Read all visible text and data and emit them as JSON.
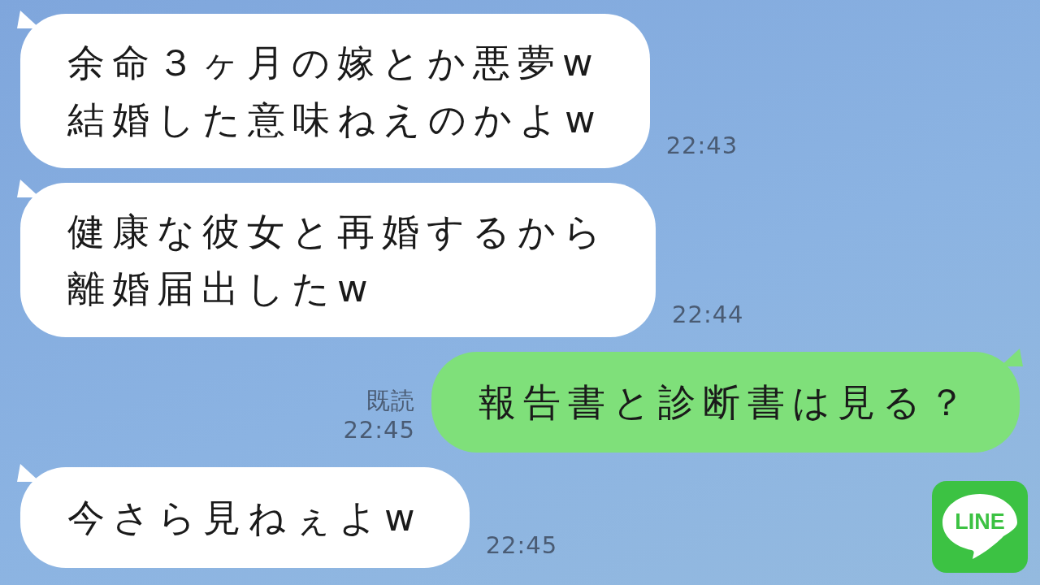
{
  "messages": [
    {
      "kind": "incoming",
      "lines": [
        "余命３ヶ月の嫁とか悪夢w",
        "結婚した意味ねえのかよw"
      ],
      "time": "22:43"
    },
    {
      "kind": "incoming",
      "lines": [
        "健康な彼女と再婚するから",
        "離婚届出したw"
      ],
      "time": "22:44"
    },
    {
      "kind": "outgoing",
      "lines": [
        "報告書と診断書は見る？"
      ],
      "read": "既読",
      "time": "22:45"
    },
    {
      "kind": "incoming",
      "lines": [
        "今さら見ねぇよw"
      ],
      "time": "22:45"
    }
  ],
  "logo": {
    "text": "LINE"
  }
}
